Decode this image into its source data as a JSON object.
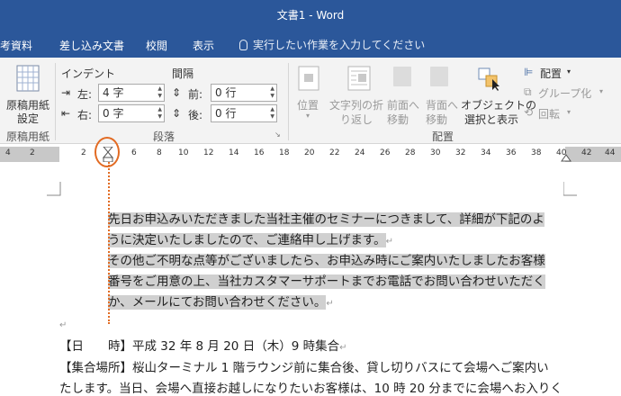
{
  "window": {
    "title": "文書1 - Word"
  },
  "tabs": [
    "考資料",
    "差し込み文書",
    "校閲",
    "表示"
  ],
  "tell_me": "実行したい作業を入力してください",
  "ribbon": {
    "genko": {
      "label_line1": "原稿用紙",
      "label_line2": "設定",
      "group": "原稿用紙"
    },
    "indent": {
      "heading": "インデント",
      "left_label": "左:",
      "left_value": "4 字",
      "right_label": "右:",
      "right_value": "0 字"
    },
    "spacing": {
      "heading": "間隔",
      "before_label": "前:",
      "before_value": "0 行",
      "after_label": "後:",
      "after_value": "0 行"
    },
    "paragraph_group": "段落",
    "arrange": {
      "position": "位置",
      "wrap_line1": "文字列の折",
      "wrap_line2": "り返し",
      "forward_line1": "前面へ",
      "forward_line2": "移動",
      "backward_line1": "背面へ",
      "backward_line2": "移動",
      "select_line1": "オブジェクトの",
      "select_line2": "選択と表示",
      "align": "配置",
      "group_btn": "グループ化",
      "rotate": "回転",
      "group": "配置"
    }
  },
  "ruler": {
    "numbers": [
      "4",
      "2",
      "2",
      "4",
      "6",
      "8",
      "10",
      "12",
      "14",
      "16",
      "18",
      "20",
      "22",
      "24",
      "26",
      "28",
      "30",
      "32",
      "34",
      "36",
      "38",
      "40",
      "42",
      "44"
    ]
  },
  "document": {
    "lines": [
      "先日お申込みいただきました当社主催のセミナーにつきまして、詳細が下記のよ",
      "うに決定いたしましたので、ご連絡申し上げます。",
      "その他ご不明な点等がございましたら、お申込み時にご案内いたしましたお客様",
      "番号をご用意の上、当社カスタマーサポートまでお電話でお問い合わせいただく",
      "か、メールにてお問い合わせください。",
      "【日　　時】平成 32 年 8 月 20 日（木）9 時集合",
      "【集合場所】桜山ターミナル 1 階ラウンジ前に集合後、貸し切りバスにて会場へご案内い",
      "たします。当日、会場へ直接お越しになりたいお客様は、10 時 20 分までに会場へお入りく"
    ],
    "para_mark": "↵"
  }
}
